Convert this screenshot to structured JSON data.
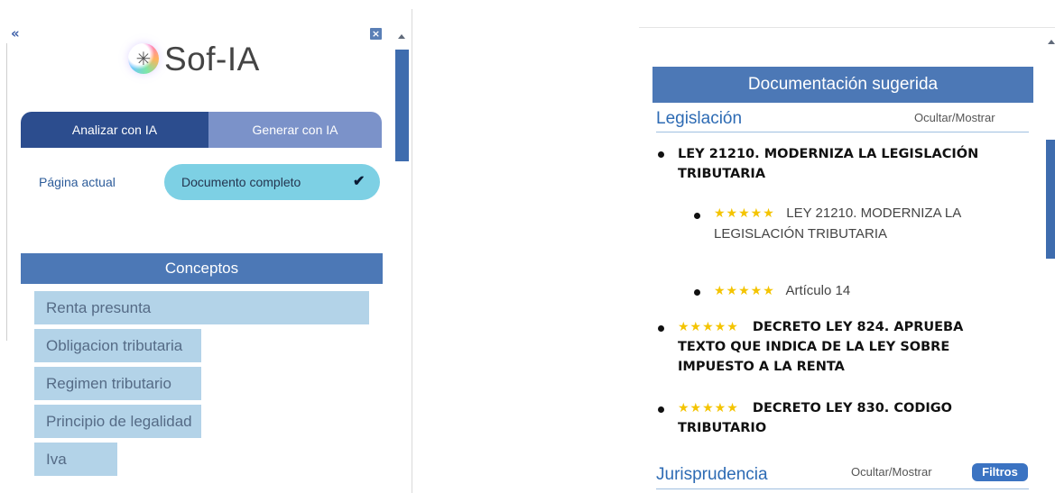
{
  "left": {
    "brand": {
      "name": "Sof-IA",
      "logo_icon": "sparkle-logo-icon"
    },
    "tabs": [
      {
        "label": "Analizar con IA",
        "active": true
      },
      {
        "label": "Generar con IA",
        "active": false
      }
    ],
    "scope": {
      "page_label": "Página actual",
      "full_label": "Documento completo",
      "full_selected": true
    },
    "concepts": {
      "title": "Conceptos",
      "items": [
        "Renta presunta",
        "Obligacion tributaria",
        "Regimen tributario",
        "Principio de legalidad",
        "Iva"
      ]
    },
    "icons": {
      "collapse": "«",
      "close": "×"
    }
  },
  "right": {
    "header": "Documentación sugerida",
    "legislacion": {
      "title": "Legislación",
      "toggle": "Ocultar/Mostrar",
      "items": [
        {
          "text": "LEY 21210. MODERNIZA LA LEGISLACIÓN TRIBUTARIA",
          "stars": ""
        },
        {
          "text": "LEY 21210. MODERNIZA LA LEGISLACIÓN TRIBUTARIA",
          "stars": "★★★★★",
          "sub": true
        },
        {
          "text": "Artículo 14",
          "stars": "★★★★★",
          "sub": true
        },
        {
          "text": "DECRETO LEY 824. APRUEBA TEXTO QUE INDICA DE LA LEY SOBRE IMPUESTO A LA RENTA",
          "stars": "★★★★★"
        },
        {
          "text": "DECRETO LEY 830. CODIGO TRIBUTARIO",
          "stars": "★★★★★"
        }
      ]
    },
    "jurisprudencia": {
      "title": "Jurisprudencia",
      "toggle": "Ocultar/Mostrar",
      "filter_label": "Filtros"
    }
  },
  "colors": {
    "primary_dark": "#2c4d8e",
    "primary": "#4c78b6",
    "tab_inactive": "#7b92c9",
    "pill": "#7dd0e4",
    "concept_bg": "#b3d3e8",
    "star": "#f4c400"
  }
}
